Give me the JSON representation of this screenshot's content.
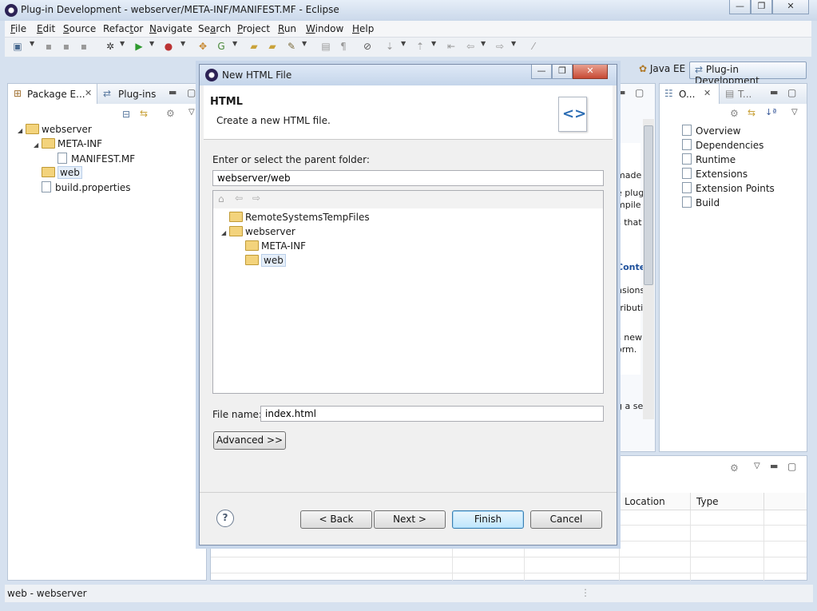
{
  "window": {
    "title": "Plug-in Development - webserver/META-INF/MANIFEST.MF - Eclipse",
    "controls": {
      "minimize": "—",
      "maximize": "❐",
      "close": "✕"
    }
  },
  "menubar": {
    "items": [
      {
        "label": "File",
        "mnemonic": "F"
      },
      {
        "label": "Edit",
        "mnemonic": "E"
      },
      {
        "label": "Source",
        "mnemonic": "S"
      },
      {
        "label": "Refactor",
        "mnemonic": "t"
      },
      {
        "label": "Navigate",
        "mnemonic": "N"
      },
      {
        "label": "Search",
        "mnemonic": "a"
      },
      {
        "label": "Project",
        "mnemonic": "P"
      },
      {
        "label": "Run",
        "mnemonic": "R"
      },
      {
        "label": "Window",
        "mnemonic": "W"
      },
      {
        "label": "Help",
        "mnemonic": "H"
      }
    ]
  },
  "perspectives": {
    "java_ee": "Java EE",
    "plugin_dev": "Plug-in Development"
  },
  "left_panel": {
    "tabs": [
      {
        "label": "Package E..."
      },
      {
        "label": "Plug-ins"
      }
    ],
    "tree": [
      {
        "label": "webserver",
        "type": "project",
        "expanded": true,
        "depth": 0
      },
      {
        "label": "META-INF",
        "type": "folder",
        "expanded": true,
        "depth": 1
      },
      {
        "label": "MANIFEST.MF",
        "type": "file",
        "depth": 2
      },
      {
        "label": "web",
        "type": "folder",
        "selected": true,
        "depth": 1
      },
      {
        "label": "build.properties",
        "type": "file",
        "depth": 1
      }
    ]
  },
  "editor_fragments": {
    "lines": [
      "made",
      "e plug",
      "mpile",
      "s that",
      "Conte",
      "nsions",
      "tributi",
      "s new",
      "orm.",
      "g a sep"
    ]
  },
  "right_panel": {
    "tabs": [
      {
        "label": "O..."
      },
      {
        "label": "T..."
      }
    ],
    "items": [
      "Overview",
      "Dependencies",
      "Runtime",
      "Extensions",
      "Extension Points",
      "Build"
    ]
  },
  "bottom_panel": {
    "columns": [
      "Location",
      "Type"
    ]
  },
  "dialog": {
    "title": "New HTML File",
    "header_title": "HTML",
    "header_desc": "Create a new HTML file.",
    "parent_folder_label": "Enter or select the parent folder:",
    "parent_folder_value": "webserver/web",
    "folder_tree": [
      {
        "label": "RemoteSystemsTempFiles",
        "depth": 0
      },
      {
        "label": "webserver",
        "depth": 0,
        "expanded": true
      },
      {
        "label": "META-INF",
        "depth": 1
      },
      {
        "label": "web",
        "depth": 1,
        "selected": true
      }
    ],
    "file_name_label": "File name:",
    "file_name_value": "index.html",
    "advanced_button": "Advanced >>",
    "help_icon": "?",
    "buttons": {
      "back": "< Back",
      "next": "Next >",
      "finish": "Finish",
      "cancel": "Cancel"
    }
  },
  "statusbar": {
    "text": "web - webserver"
  }
}
